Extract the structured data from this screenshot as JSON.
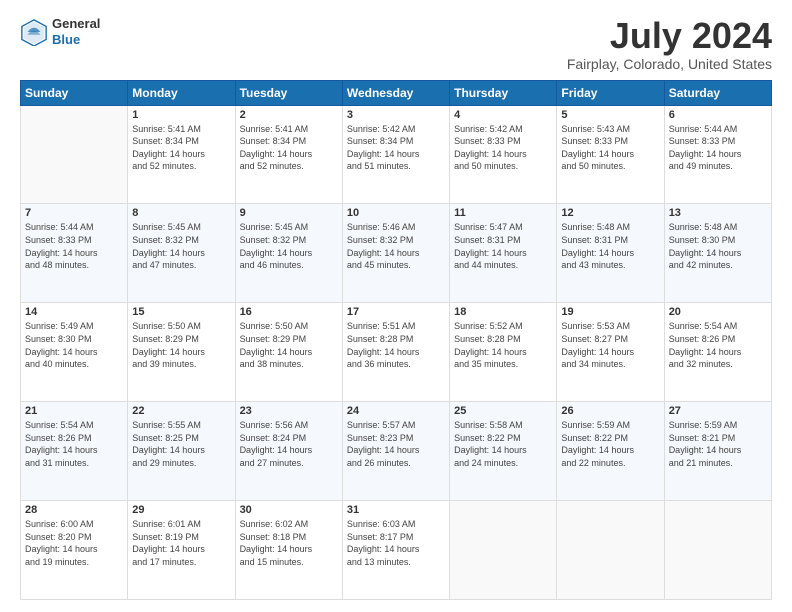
{
  "logo": {
    "general": "General",
    "blue": "Blue"
  },
  "title": "July 2024",
  "subtitle": "Fairplay, Colorado, United States",
  "headers": [
    "Sunday",
    "Monday",
    "Tuesday",
    "Wednesday",
    "Thursday",
    "Friday",
    "Saturday"
  ],
  "weeks": [
    [
      {
        "day": "",
        "info": ""
      },
      {
        "day": "1",
        "info": "Sunrise: 5:41 AM\nSunset: 8:34 PM\nDaylight: 14 hours\nand 52 minutes."
      },
      {
        "day": "2",
        "info": "Sunrise: 5:41 AM\nSunset: 8:34 PM\nDaylight: 14 hours\nand 52 minutes."
      },
      {
        "day": "3",
        "info": "Sunrise: 5:42 AM\nSunset: 8:34 PM\nDaylight: 14 hours\nand 51 minutes."
      },
      {
        "day": "4",
        "info": "Sunrise: 5:42 AM\nSunset: 8:33 PM\nDaylight: 14 hours\nand 50 minutes."
      },
      {
        "day": "5",
        "info": "Sunrise: 5:43 AM\nSunset: 8:33 PM\nDaylight: 14 hours\nand 50 minutes."
      },
      {
        "day": "6",
        "info": "Sunrise: 5:44 AM\nSunset: 8:33 PM\nDaylight: 14 hours\nand 49 minutes."
      }
    ],
    [
      {
        "day": "7",
        "info": "Sunrise: 5:44 AM\nSunset: 8:33 PM\nDaylight: 14 hours\nand 48 minutes."
      },
      {
        "day": "8",
        "info": "Sunrise: 5:45 AM\nSunset: 8:32 PM\nDaylight: 14 hours\nand 47 minutes."
      },
      {
        "day": "9",
        "info": "Sunrise: 5:45 AM\nSunset: 8:32 PM\nDaylight: 14 hours\nand 46 minutes."
      },
      {
        "day": "10",
        "info": "Sunrise: 5:46 AM\nSunset: 8:32 PM\nDaylight: 14 hours\nand 45 minutes."
      },
      {
        "day": "11",
        "info": "Sunrise: 5:47 AM\nSunset: 8:31 PM\nDaylight: 14 hours\nand 44 minutes."
      },
      {
        "day": "12",
        "info": "Sunrise: 5:48 AM\nSunset: 8:31 PM\nDaylight: 14 hours\nand 43 minutes."
      },
      {
        "day": "13",
        "info": "Sunrise: 5:48 AM\nSunset: 8:30 PM\nDaylight: 14 hours\nand 42 minutes."
      }
    ],
    [
      {
        "day": "14",
        "info": "Sunrise: 5:49 AM\nSunset: 8:30 PM\nDaylight: 14 hours\nand 40 minutes."
      },
      {
        "day": "15",
        "info": "Sunrise: 5:50 AM\nSunset: 8:29 PM\nDaylight: 14 hours\nand 39 minutes."
      },
      {
        "day": "16",
        "info": "Sunrise: 5:50 AM\nSunset: 8:29 PM\nDaylight: 14 hours\nand 38 minutes."
      },
      {
        "day": "17",
        "info": "Sunrise: 5:51 AM\nSunset: 8:28 PM\nDaylight: 14 hours\nand 36 minutes."
      },
      {
        "day": "18",
        "info": "Sunrise: 5:52 AM\nSunset: 8:28 PM\nDaylight: 14 hours\nand 35 minutes."
      },
      {
        "day": "19",
        "info": "Sunrise: 5:53 AM\nSunset: 8:27 PM\nDaylight: 14 hours\nand 34 minutes."
      },
      {
        "day": "20",
        "info": "Sunrise: 5:54 AM\nSunset: 8:26 PM\nDaylight: 14 hours\nand 32 minutes."
      }
    ],
    [
      {
        "day": "21",
        "info": "Sunrise: 5:54 AM\nSunset: 8:26 PM\nDaylight: 14 hours\nand 31 minutes."
      },
      {
        "day": "22",
        "info": "Sunrise: 5:55 AM\nSunset: 8:25 PM\nDaylight: 14 hours\nand 29 minutes."
      },
      {
        "day": "23",
        "info": "Sunrise: 5:56 AM\nSunset: 8:24 PM\nDaylight: 14 hours\nand 27 minutes."
      },
      {
        "day": "24",
        "info": "Sunrise: 5:57 AM\nSunset: 8:23 PM\nDaylight: 14 hours\nand 26 minutes."
      },
      {
        "day": "25",
        "info": "Sunrise: 5:58 AM\nSunset: 8:22 PM\nDaylight: 14 hours\nand 24 minutes."
      },
      {
        "day": "26",
        "info": "Sunrise: 5:59 AM\nSunset: 8:22 PM\nDaylight: 14 hours\nand 22 minutes."
      },
      {
        "day": "27",
        "info": "Sunrise: 5:59 AM\nSunset: 8:21 PM\nDaylight: 14 hours\nand 21 minutes."
      }
    ],
    [
      {
        "day": "28",
        "info": "Sunrise: 6:00 AM\nSunset: 8:20 PM\nDaylight: 14 hours\nand 19 minutes."
      },
      {
        "day": "29",
        "info": "Sunrise: 6:01 AM\nSunset: 8:19 PM\nDaylight: 14 hours\nand 17 minutes."
      },
      {
        "day": "30",
        "info": "Sunrise: 6:02 AM\nSunset: 8:18 PM\nDaylight: 14 hours\nand 15 minutes."
      },
      {
        "day": "31",
        "info": "Sunrise: 6:03 AM\nSunset: 8:17 PM\nDaylight: 14 hours\nand 13 minutes."
      },
      {
        "day": "",
        "info": ""
      },
      {
        "day": "",
        "info": ""
      },
      {
        "day": "",
        "info": ""
      }
    ]
  ]
}
